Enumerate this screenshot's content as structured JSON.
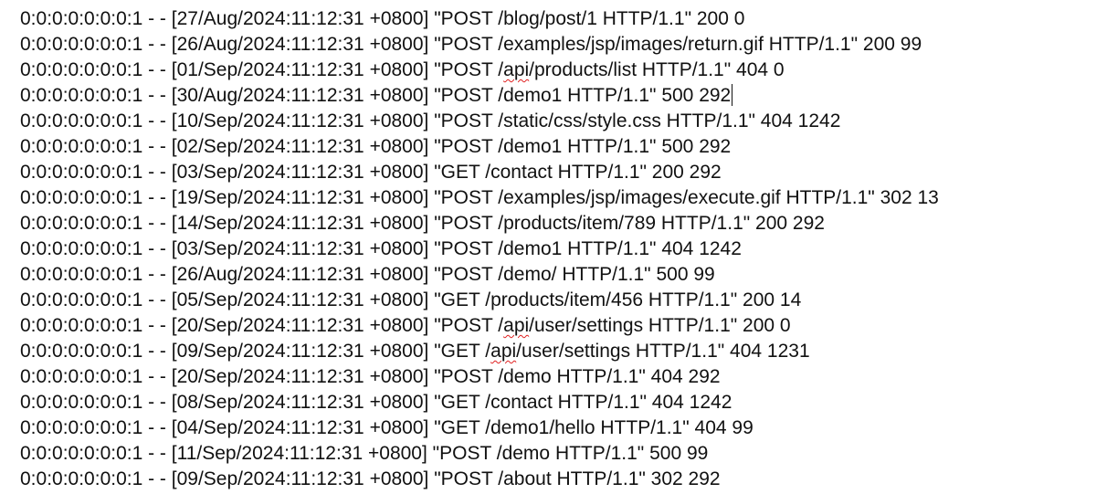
{
  "editor": {
    "caret_line": 3,
    "spell_word": "api",
    "lines": [
      "0:0:0:0:0:0:0:1 - - [27/Aug/2024:11:12:31 +0800] \"POST /blog/post/1 HTTP/1.1\" 200 0",
      "0:0:0:0:0:0:0:1 - - [26/Aug/2024:11:12:31 +0800] \"POST /examples/jsp/images/return.gif HTTP/1.1\" 200 99",
      "0:0:0:0:0:0:0:1 - - [01/Sep/2024:11:12:31 +0800] \"POST /api/products/list HTTP/1.1\" 404 0",
      "0:0:0:0:0:0:0:1 - - [30/Aug/2024:11:12:31 +0800] \"POST /demo1 HTTP/1.1\" 500 292",
      "0:0:0:0:0:0:0:1 - - [10/Sep/2024:11:12:31 +0800] \"POST /static/css/style.css HTTP/1.1\" 404 1242",
      "0:0:0:0:0:0:0:1 - - [02/Sep/2024:11:12:31 +0800] \"POST /demo1 HTTP/1.1\" 500 292",
      "0:0:0:0:0:0:0:1 - - [03/Sep/2024:11:12:31 +0800] \"GET /contact HTTP/1.1\" 200 292",
      "0:0:0:0:0:0:0:1 - - [19/Sep/2024:11:12:31 +0800] \"POST /examples/jsp/images/execute.gif HTTP/1.1\" 302 13",
      "0:0:0:0:0:0:0:1 - - [14/Sep/2024:11:12:31 +0800] \"POST /products/item/789 HTTP/1.1\" 200 292",
      "0:0:0:0:0:0:0:1 - - [03/Sep/2024:11:12:31 +0800] \"POST /demo1 HTTP/1.1\" 404 1242",
      "0:0:0:0:0:0:0:1 - - [26/Aug/2024:11:12:31 +0800] \"POST /demo/ HTTP/1.1\" 500 99",
      "0:0:0:0:0:0:0:1 - - [05/Sep/2024:11:12:31 +0800] \"GET /products/item/456 HTTP/1.1\" 200 14",
      "0:0:0:0:0:0:0:1 - - [20/Sep/2024:11:12:31 +0800] \"POST /api/user/settings HTTP/1.1\" 200 0",
      "0:0:0:0:0:0:0:1 - - [09/Sep/2024:11:12:31 +0800] \"GET /api/user/settings HTTP/1.1\" 404 1231",
      "0:0:0:0:0:0:0:1 - - [20/Sep/2024:11:12:31 +0800] \"POST /demo HTTP/1.1\" 404 292",
      "0:0:0:0:0:0:0:1 - - [08/Sep/2024:11:12:31 +0800] \"GET /contact HTTP/1.1\" 404 1242",
      "0:0:0:0:0:0:0:1 - - [04/Sep/2024:11:12:31 +0800] \"GET /demo1/hello HTTP/1.1\" 404 99",
      "0:0:0:0:0:0:0:1 - - [11/Sep/2024:11:12:31 +0800] \"POST /demo HTTP/1.1\" 500 99",
      "0:0:0:0:0:0:0:1 - - [09/Sep/2024:11:12:31 +0800] \"POST /about HTTP/1.1\" 302 292"
    ]
  }
}
